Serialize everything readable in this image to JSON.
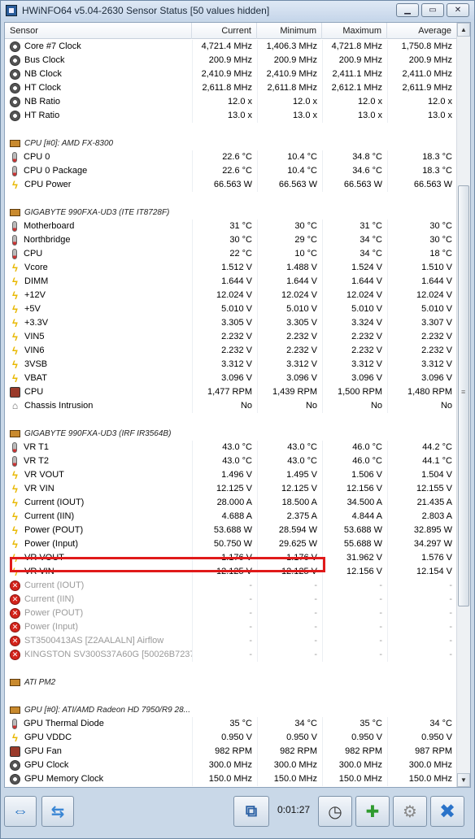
{
  "window": {
    "title": "HWiNFO64 v5.04-2630 Sensor Status [50 values hidden]"
  },
  "columns": {
    "sensor": "Sensor",
    "current": "Current",
    "minimum": "Minimum",
    "maximum": "Maximum",
    "average": "Average"
  },
  "rows": [
    {
      "kind": "data",
      "icon": "clock-icon",
      "name": "Core #7 Clock",
      "cur": "4,721.4 MHz",
      "min": "1,406.3 MHz",
      "max": "4,721.8 MHz",
      "avg": "1,750.8 MHz"
    },
    {
      "kind": "data",
      "icon": "clock-icon",
      "name": "Bus Clock",
      "cur": "200.9 MHz",
      "min": "200.9 MHz",
      "max": "200.9 MHz",
      "avg": "200.9 MHz"
    },
    {
      "kind": "data",
      "icon": "clock-icon",
      "name": "NB Clock",
      "cur": "2,410.9 MHz",
      "min": "2,410.9 MHz",
      "max": "2,411.1 MHz",
      "avg": "2,411.0 MHz"
    },
    {
      "kind": "data",
      "icon": "clock-icon",
      "name": "HT Clock",
      "cur": "2,611.8 MHz",
      "min": "2,611.8 MHz",
      "max": "2,612.1 MHz",
      "avg": "2,611.9 MHz"
    },
    {
      "kind": "data",
      "icon": "clock-icon",
      "name": "NB Ratio",
      "cur": "12.0 x",
      "min": "12.0 x",
      "max": "12.0 x",
      "avg": "12.0 x"
    },
    {
      "kind": "data",
      "icon": "clock-icon",
      "name": "HT Ratio",
      "cur": "13.0 x",
      "min": "13.0 x",
      "max": "13.0 x",
      "avg": "13.0 x"
    },
    {
      "kind": "gap"
    },
    {
      "kind": "group",
      "icon": "chip-icon",
      "name": "CPU [#0]: AMD FX-8300"
    },
    {
      "kind": "data",
      "icon": "thermometer-icon",
      "name": "CPU 0",
      "cur": "22.6 °C",
      "min": "10.4 °C",
      "max": "34.8 °C",
      "avg": "18.3 °C"
    },
    {
      "kind": "data",
      "icon": "thermometer-icon",
      "name": "CPU 0 Package",
      "cur": "22.6 °C",
      "min": "10.4 °C",
      "max": "34.6 °C",
      "avg": "18.3 °C"
    },
    {
      "kind": "data",
      "icon": "bolt-icon",
      "name": "CPU Power",
      "cur": "66.563 W",
      "min": "66.563 W",
      "max": "66.563 W",
      "avg": "66.563 W"
    },
    {
      "kind": "gap"
    },
    {
      "kind": "group",
      "icon": "chip-icon",
      "name": "GIGABYTE 990FXA-UD3 (ITE IT8728F)"
    },
    {
      "kind": "data",
      "icon": "thermometer-icon",
      "name": "Motherboard",
      "cur": "31 °C",
      "min": "30 °C",
      "max": "31 °C",
      "avg": "30 °C"
    },
    {
      "kind": "data",
      "icon": "thermometer-icon",
      "name": "Northbridge",
      "cur": "30 °C",
      "min": "29 °C",
      "max": "34 °C",
      "avg": "30 °C"
    },
    {
      "kind": "data",
      "icon": "thermometer-icon",
      "name": "CPU",
      "cur": "22 °C",
      "min": "10 °C",
      "max": "34 °C",
      "avg": "18 °C"
    },
    {
      "kind": "data",
      "icon": "bolt-icon",
      "name": "Vcore",
      "cur": "1.512 V",
      "min": "1.488 V",
      "max": "1.524 V",
      "avg": "1.510 V"
    },
    {
      "kind": "data",
      "icon": "bolt-icon",
      "name": "DIMM",
      "cur": "1.644 V",
      "min": "1.644 V",
      "max": "1.644 V",
      "avg": "1.644 V"
    },
    {
      "kind": "data",
      "icon": "bolt-icon",
      "name": "+12V",
      "cur": "12.024 V",
      "min": "12.024 V",
      "max": "12.024 V",
      "avg": "12.024 V"
    },
    {
      "kind": "data",
      "icon": "bolt-icon",
      "name": "+5V",
      "cur": "5.010 V",
      "min": "5.010 V",
      "max": "5.010 V",
      "avg": "5.010 V"
    },
    {
      "kind": "data",
      "icon": "bolt-icon",
      "name": "+3.3V",
      "cur": "3.305 V",
      "min": "3.305 V",
      "max": "3.324 V",
      "avg": "3.307 V"
    },
    {
      "kind": "data",
      "icon": "bolt-icon",
      "name": "VIN5",
      "cur": "2.232 V",
      "min": "2.232 V",
      "max": "2.232 V",
      "avg": "2.232 V"
    },
    {
      "kind": "data",
      "icon": "bolt-icon",
      "name": "VIN6",
      "cur": "2.232 V",
      "min": "2.232 V",
      "max": "2.232 V",
      "avg": "2.232 V"
    },
    {
      "kind": "data",
      "icon": "bolt-icon",
      "name": "3VSB",
      "cur": "3.312 V",
      "min": "3.312 V",
      "max": "3.312 V",
      "avg": "3.312 V"
    },
    {
      "kind": "data",
      "icon": "bolt-icon",
      "name": "VBAT",
      "cur": "3.096 V",
      "min": "3.096 V",
      "max": "3.096 V",
      "avg": "3.096 V"
    },
    {
      "kind": "data",
      "icon": "fan-icon",
      "name": "CPU",
      "cur": "1,477 RPM",
      "min": "1,439 RPM",
      "max": "1,500 RPM",
      "avg": "1,480 RPM"
    },
    {
      "kind": "data",
      "icon": "shield-icon",
      "name": "Chassis Intrusion",
      "cur": "No",
      "min": "No",
      "max": "No",
      "avg": "No"
    },
    {
      "kind": "gap"
    },
    {
      "kind": "group",
      "icon": "chip-icon",
      "name": "GIGABYTE 990FXA-UD3 (IRF IR3564B)"
    },
    {
      "kind": "data",
      "icon": "thermometer-icon",
      "name": "VR T1",
      "cur": "43.0 °C",
      "min": "43.0 °C",
      "max": "46.0 °C",
      "avg": "44.2 °C"
    },
    {
      "kind": "data",
      "icon": "thermometer-icon",
      "name": "VR T2",
      "cur": "43.0 °C",
      "min": "43.0 °C",
      "max": "46.0 °C",
      "avg": "44.1 °C"
    },
    {
      "kind": "data",
      "icon": "bolt-icon",
      "name": "VR VOUT",
      "cur": "1.496 V",
      "min": "1.495 V",
      "max": "1.506 V",
      "avg": "1.504 V"
    },
    {
      "kind": "data",
      "icon": "bolt-icon",
      "name": "VR VIN",
      "cur": "12.125 V",
      "min": "12.125 V",
      "max": "12.156 V",
      "avg": "12.155 V"
    },
    {
      "kind": "data",
      "icon": "bolt-icon",
      "name": "Current (IOUT)",
      "cur": "28.000 A",
      "min": "18.500 A",
      "max": "34.500 A",
      "avg": "21.435 A"
    },
    {
      "kind": "data",
      "icon": "bolt-icon",
      "name": "Current (IIN)",
      "cur": "4.688 A",
      "min": "2.375 A",
      "max": "4.844 A",
      "avg": "2.803 A"
    },
    {
      "kind": "data",
      "icon": "bolt-icon",
      "name": "Power (POUT)",
      "cur": "53.688 W",
      "min": "28.594 W",
      "max": "53.688 W",
      "avg": "32.895 W"
    },
    {
      "kind": "data",
      "icon": "bolt-icon",
      "name": "Power (Input)",
      "cur": "50.750 W",
      "min": "29.625 W",
      "max": "55.688 W",
      "avg": "34.297 W"
    },
    {
      "kind": "data",
      "icon": "bolt-icon",
      "name": "VR VOUT",
      "cur": "1.176 V",
      "min": "1.176 V",
      "max": "31.962 V",
      "avg": "1.576 V"
    },
    {
      "kind": "data",
      "icon": "bolt-icon",
      "name": "VR VIN",
      "cur": "12.125 V",
      "min": "12.125 V",
      "max": "12.156 V",
      "avg": "12.154 V"
    },
    {
      "kind": "disabled",
      "icon": "error-icon",
      "name": "Current (IOUT)",
      "cur": "-",
      "min": "-",
      "max": "-",
      "avg": "-"
    },
    {
      "kind": "disabled",
      "icon": "error-icon",
      "name": "Current (IIN)",
      "cur": "-",
      "min": "-",
      "max": "-",
      "avg": "-"
    },
    {
      "kind": "disabled",
      "icon": "error-icon",
      "name": "Power (POUT)",
      "cur": "-",
      "min": "-",
      "max": "-",
      "avg": "-"
    },
    {
      "kind": "disabled",
      "icon": "error-icon",
      "name": "Power (Input)",
      "cur": "-",
      "min": "-",
      "max": "-",
      "avg": "-"
    },
    {
      "kind": "disabled",
      "icon": "error-icon",
      "name": "ST3500413AS [Z2AALALN] Airflow",
      "cur": "-",
      "min": "-",
      "max": "-",
      "avg": "-"
    },
    {
      "kind": "disabled",
      "icon": "error-icon",
      "name": "KINGSTON SV300S37A60G [50026B7237...",
      "cur": "-",
      "min": "-",
      "max": "-",
      "avg": "-"
    },
    {
      "kind": "gap"
    },
    {
      "kind": "group",
      "icon": "chip-icon",
      "name": "ATI PM2"
    },
    {
      "kind": "gap"
    },
    {
      "kind": "group",
      "icon": "chip-icon",
      "name": "GPU [#0]: ATI/AMD Radeon HD 7950/R9 28..."
    },
    {
      "kind": "data",
      "icon": "thermometer-icon",
      "name": "GPU Thermal Diode",
      "cur": "35 °C",
      "min": "34 °C",
      "max": "35 °C",
      "avg": "34 °C"
    },
    {
      "kind": "data",
      "icon": "bolt-icon",
      "name": "GPU VDDC",
      "cur": "0.950 V",
      "min": "0.950 V",
      "max": "0.950 V",
      "avg": "0.950 V"
    },
    {
      "kind": "data",
      "icon": "fan-icon",
      "name": "GPU Fan",
      "cur": "982 RPM",
      "min": "982 RPM",
      "max": "982 RPM",
      "avg": "987 RPM"
    },
    {
      "kind": "data",
      "icon": "clock-icon",
      "name": "GPU Clock",
      "cur": "300.0 MHz",
      "min": "300.0 MHz",
      "max": "300.0 MHz",
      "avg": "300.0 MHz"
    },
    {
      "kind": "data",
      "icon": "clock-icon",
      "name": "GPU Memory Clock",
      "cur": "150.0 MHz",
      "min": "150.0 MHz",
      "max": "150.0 MHz",
      "avg": "150.0 MHz"
    }
  ],
  "toolbar": {
    "expand_icon": "expand-arrows-icon",
    "collapse_icon": "collapse-arrows-icon",
    "network_icon": "network-computers-icon",
    "timer": "0:01:27",
    "clock_icon": "clock-icon",
    "log_icon": "log-add-icon",
    "settings_icon": "gear-icon",
    "close_icon": "close-icon"
  },
  "colors": {
    "highlight_box": "#e01a1a",
    "bolt": "#e8b800",
    "error": "#d4231b"
  }
}
